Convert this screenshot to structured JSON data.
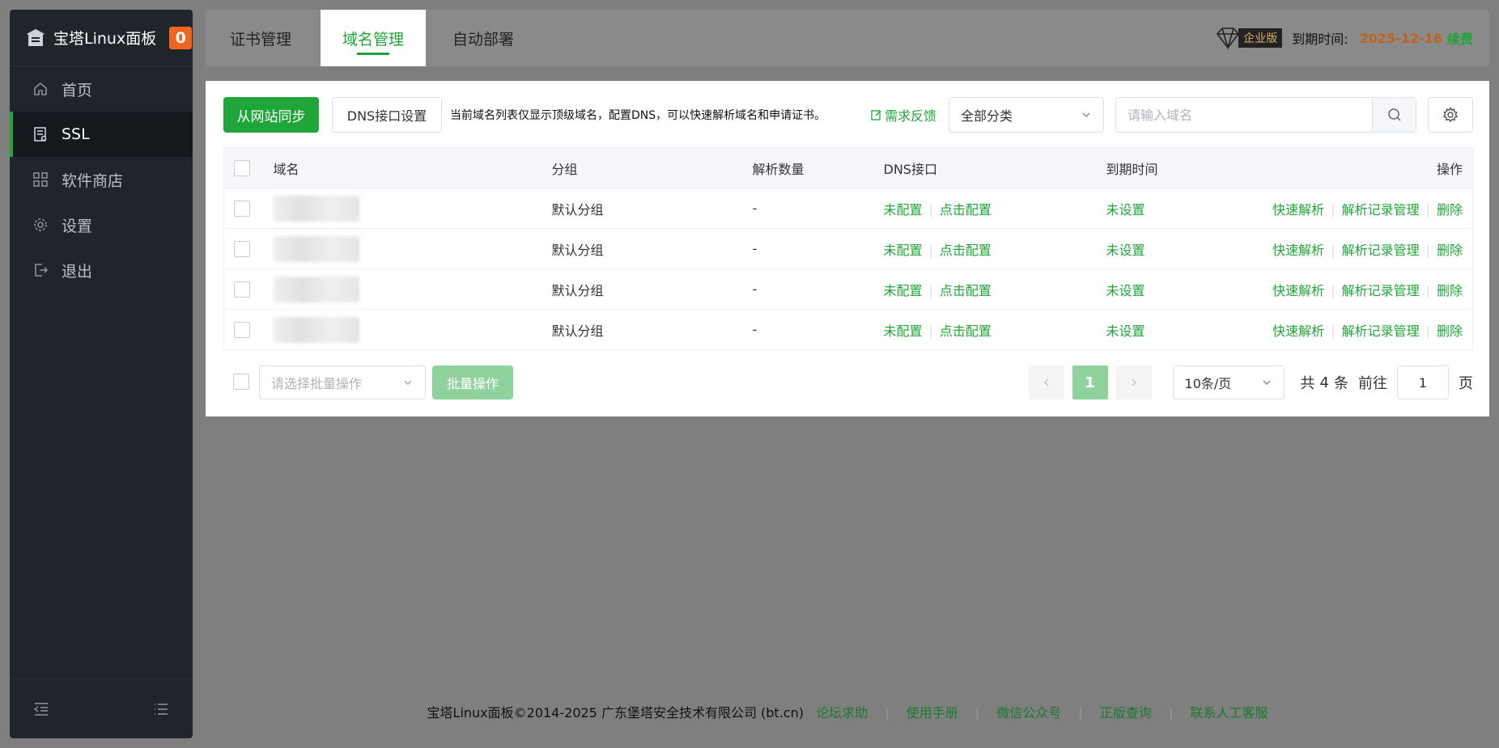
{
  "sidebar": {
    "brand": "宝塔Linux面板",
    "badge": "0",
    "items": [
      {
        "label": "首页",
        "icon": "home-icon"
      },
      {
        "label": "SSL",
        "icon": "certificate-icon"
      },
      {
        "label": "软件商店",
        "icon": "grid-icon"
      },
      {
        "label": "设置",
        "icon": "gear-icon"
      },
      {
        "label": "退出",
        "icon": "logout-icon"
      }
    ],
    "active_index": 1
  },
  "topbar": {
    "tabs": [
      {
        "label": "证书管理"
      },
      {
        "label": "域名管理"
      },
      {
        "label": "自动部署"
      }
    ],
    "active_tab": 1,
    "edition": "企业版",
    "expire_label": "到期时间:",
    "expire_date": "2025-12-16",
    "renew": "续费"
  },
  "toolbar": {
    "sync_button": "从网站同步",
    "dns_button": "DNS接口设置",
    "tip": "当前域名列表仅显示顶级域名，配置DNS，可以快速解析域名和申请证书。",
    "feedback": "需求反馈",
    "category": "全部分类",
    "search_placeholder": "请输入域名"
  },
  "table": {
    "headers": [
      "域名",
      "分组",
      "解析数量",
      "DNS接口",
      "到期时间",
      "操作"
    ],
    "rows": [
      {
        "group": "默认分组",
        "count": "-",
        "dns_status": "未配置",
        "dns_action": "点击配置",
        "expire": "未设置"
      },
      {
        "group": "默认分组",
        "count": "-",
        "dns_status": "未配置",
        "dns_action": "点击配置",
        "expire": "未设置"
      },
      {
        "group": "默认分组",
        "count": "-",
        "dns_status": "未配置",
        "dns_action": "点击配置",
        "expire": "未设置"
      },
      {
        "group": "默认分组",
        "count": "-",
        "dns_status": "未配置",
        "dns_action": "点击配置",
        "expire": "未设置"
      }
    ],
    "ops": [
      "快速解析",
      "解析记录管理",
      "删除"
    ]
  },
  "batch": {
    "placeholder": "请选择批量操作",
    "button": "批量操作"
  },
  "pager": {
    "current": "1",
    "page_size": "10条/页",
    "total_prefix": "共",
    "total": "4",
    "total_suffix": "条",
    "goto_label": "前往",
    "goto_value": "1",
    "page_suffix": "页"
  },
  "footer": {
    "copyright": "宝塔Linux面板©2014-2025 广东堡塔安全技术有限公司 (bt.cn)",
    "links": [
      "论坛求助",
      "使用手册",
      "微信公众号",
      "正版查询",
      "联系人工客服"
    ]
  }
}
